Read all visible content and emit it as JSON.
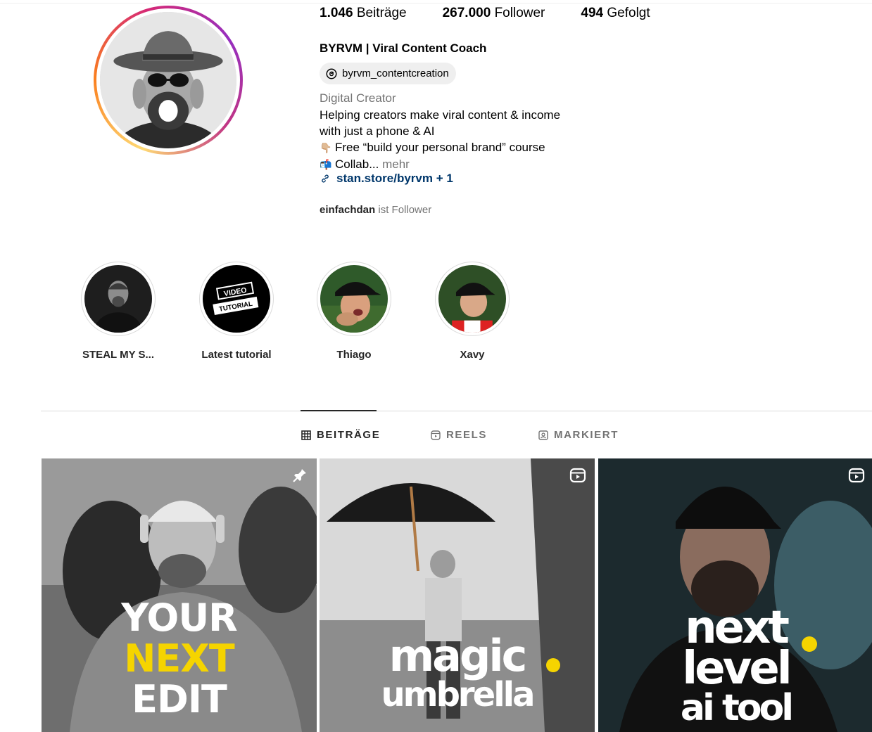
{
  "profile": {
    "stats": {
      "posts_count": "1.046",
      "posts_label": "Beiträge",
      "followers_count": "267.000",
      "followers_label": "Follower",
      "following_count": "494",
      "following_label": "Gefolgt"
    },
    "full_name": "BYRVM | Viral Content Coach",
    "threads_handle": "byrvm_contentcreation",
    "category": "Digital Creator",
    "bio_line1": "Helping creators make viral content & income",
    "bio_line2": "with just a phone & AI",
    "bio_line3_emoji": "👇🏼",
    "bio_line3": "Free “build your personal brand” course",
    "bio_line4_emoji": "📬",
    "bio_line4": "Collab...",
    "bio_more": "mehr",
    "link_text": "stan.store/byrvm + 1",
    "followed_by_user": "einfachdan",
    "followed_by_suffix": "ist Follower"
  },
  "highlights": [
    {
      "label": "STEAL MY S..."
    },
    {
      "label": "Latest tutorial"
    },
    {
      "label": "Thiago"
    },
    {
      "label": "Xavy"
    }
  ],
  "highlight_art": {
    "video_word": "VIDEO",
    "tutorial_word": "TUTORIAL"
  },
  "tabs": [
    {
      "label": "BEITRÄGE",
      "active": true,
      "icon": "grid-icon"
    },
    {
      "label": "REELS",
      "active": false,
      "icon": "reels-icon"
    },
    {
      "label": "MARKIERT",
      "active": false,
      "icon": "tagged-icon"
    }
  ],
  "posts": [
    {
      "line1": "YOUR",
      "line2": "NEXT",
      "line3": "EDIT",
      "badge": "pin-icon"
    },
    {
      "line1": "magic",
      "line2": "umbrella",
      "badge": "reels-icon"
    },
    {
      "line1": "next",
      "line2": "level",
      "line3": "ai tool",
      "badge": "reels-icon"
    }
  ],
  "colors": {
    "link": "#00376b",
    "secondary_text": "#737373",
    "accent_yellow": "#f5d400"
  }
}
